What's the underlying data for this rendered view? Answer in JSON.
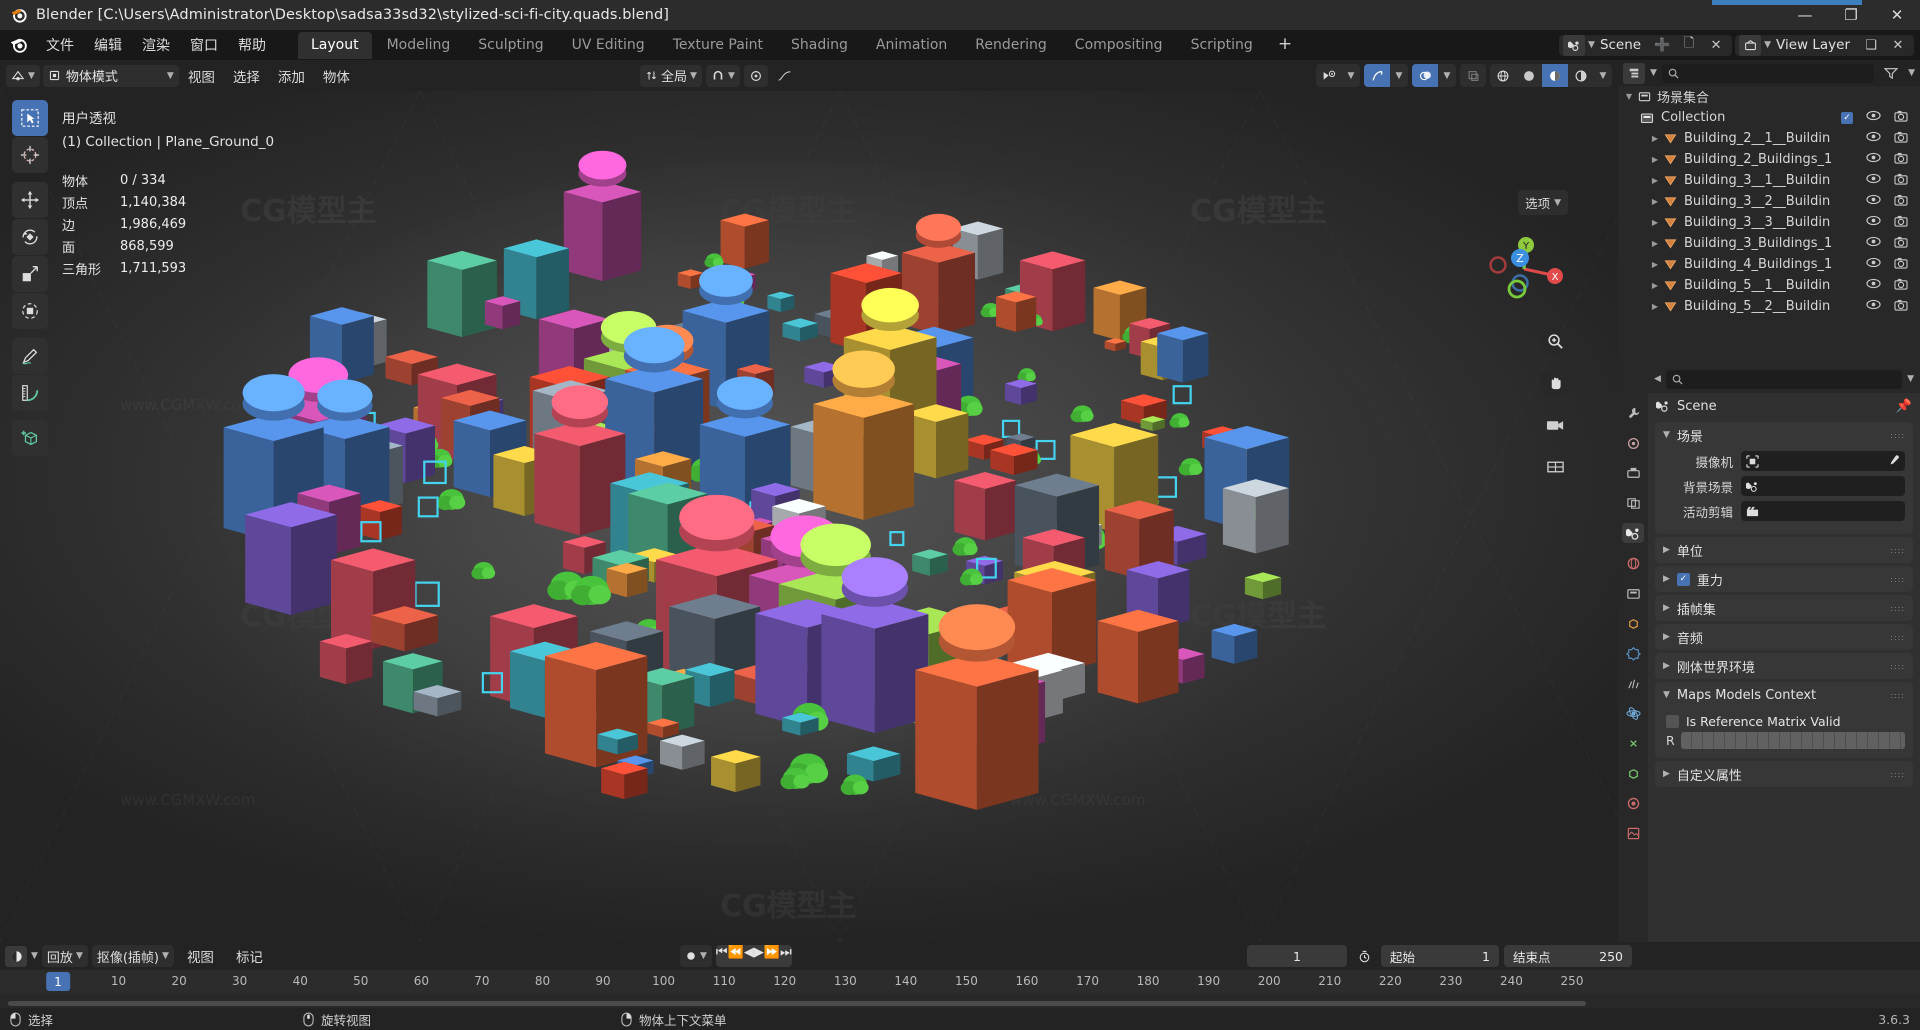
{
  "window": {
    "title": "Blender [C:\\Users\\Administrator\\Desktop\\sadsa33sd32\\stylized-sci-fi-city.quads.blend]",
    "minimize": "—",
    "maximize": "❐",
    "close": "✕"
  },
  "menubar": {
    "items": [
      "文件",
      "编辑",
      "渲染",
      "窗口",
      "帮助"
    ],
    "tabs": [
      {
        "label": "Layout",
        "active": true
      },
      {
        "label": "Modeling",
        "active": false
      },
      {
        "label": "Sculpting",
        "active": false
      },
      {
        "label": "UV Editing",
        "active": false
      },
      {
        "label": "Texture Paint",
        "active": false
      },
      {
        "label": "Shading",
        "active": false
      },
      {
        "label": "Animation",
        "active": false
      },
      {
        "label": "Rendering",
        "active": false
      },
      {
        "label": "Compositing",
        "active": false
      },
      {
        "label": "Scripting",
        "active": false
      }
    ],
    "add_tab": "+",
    "scene_name": "Scene",
    "view_layer_name": "View Layer"
  },
  "viewport_header": {
    "mode": "物体模式",
    "menus": [
      "视图",
      "选择",
      "添加",
      "物体"
    ],
    "transform_orientation": "全局"
  },
  "viewport": {
    "view_name": "用户透视",
    "collection_line": "(1) Collection | Plane_Ground_0",
    "stats": [
      {
        "key": "物体",
        "value": "0 / 334"
      },
      {
        "key": "顶点",
        "value": "1,140,384"
      },
      {
        "key": "边",
        "value": "1,986,469"
      },
      {
        "key": "面",
        "value": "868,599"
      },
      {
        "key": "三角形",
        "value": "1,711,593"
      }
    ],
    "options_label": "选项",
    "gizmo_axes": {
      "x": "X",
      "y": "Y",
      "z": "Z"
    },
    "watermark_big": "CG模型主",
    "watermark_small": "www.CGMXW.com"
  },
  "outliner": {
    "title": "场景集合",
    "search_placeholder": "",
    "collection": {
      "name": "Collection",
      "checked": true
    },
    "items": [
      {
        "name": "Building_2__1__Buildin"
      },
      {
        "name": "Building_2_Buildings_1"
      },
      {
        "name": "Building_3__1__Buildin"
      },
      {
        "name": "Building_3__2__Buildin"
      },
      {
        "name": "Building_3__3__Buildin"
      },
      {
        "name": "Building_3_Buildings_1"
      },
      {
        "name": "Building_4_Buildings_1"
      },
      {
        "name": "Building_5__1__Buildin"
      },
      {
        "name": "Building_5__2__Buildin"
      }
    ]
  },
  "properties": {
    "search_placeholder": "",
    "breadcrumb": "Scene",
    "panels": [
      {
        "id": "scene",
        "title": "场景",
        "open": true
      },
      {
        "id": "units",
        "title": "单位",
        "open": false
      },
      {
        "id": "gravity",
        "title": "重力",
        "open": false,
        "checked": true
      },
      {
        "id": "keying",
        "title": "插帧集",
        "open": false
      },
      {
        "id": "audio",
        "title": "音频",
        "open": false
      },
      {
        "id": "rigidbody",
        "title": "刚体世界环境",
        "open": false
      },
      {
        "id": "maps",
        "title": "Maps Models Context",
        "open": true
      },
      {
        "id": "custom",
        "title": "自定义属性",
        "open": false
      }
    ],
    "scene_fields": [
      {
        "label": "摄像机",
        "value": "",
        "icon": "camera-icon"
      },
      {
        "label": "背景场景",
        "value": "",
        "icon": "scene-icon"
      },
      {
        "label": "活动剪辑",
        "value": "",
        "icon": "clip-icon"
      }
    ],
    "maps_fields": {
      "checkbox_label": "Is Reference Matrix Valid",
      "checkbox_checked": false,
      "matrix_label": "R"
    }
  },
  "timeline": {
    "menus": [
      "回放",
      "抠像(插帧)",
      "视图",
      "标记"
    ],
    "transport": [
      "⏮",
      "⏪",
      "◀",
      "▶",
      "⏩",
      "⏭"
    ],
    "current_frame": "1",
    "start_label": "起始",
    "start_value": "1",
    "end_label": "结束点",
    "end_value": "250",
    "ticks": [
      "1",
      "10",
      "20",
      "30",
      "40",
      "50",
      "60",
      "70",
      "80",
      "90",
      "100",
      "110",
      "120",
      "130",
      "140",
      "150",
      "160",
      "170",
      "180",
      "190",
      "200",
      "210",
      "220",
      "230",
      "240",
      "250"
    ],
    "playhead_frame": "1"
  },
  "statusbar": {
    "items": [
      {
        "label": "选择",
        "icon": "mouse-left-icon"
      },
      {
        "label": "旋转视图",
        "icon": "mouse-middle-icon"
      },
      {
        "label": "物体上下文菜单",
        "icon": "mouse-right-icon"
      }
    ],
    "version": "3.6.3"
  },
  "colors": {
    "accent": "#4772b3",
    "header_bg": "#232323",
    "panel_bg": "#303030",
    "orange": "#e08a3c"
  }
}
